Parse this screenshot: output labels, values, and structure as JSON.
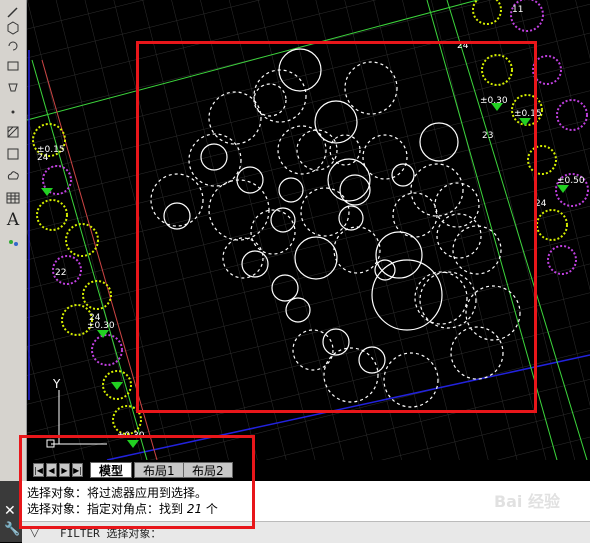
{
  "toolbar": {
    "tools": [
      "pencil-icon",
      "hexagon-icon",
      "rotate-icon",
      "stamp-icon",
      "bucket-icon",
      "point-icon",
      "hatch-icon",
      "region-icon",
      "cloud-icon",
      "table-icon",
      "text-icon",
      "attribute-icon"
    ],
    "text_tool_glyph": "A"
  },
  "canvas": {
    "plant_labels": [
      "11",
      "24",
      "±0.30",
      "23",
      "±0.15",
      "24",
      "±0.50",
      "22",
      "±0.15",
      "24",
      "±0.30",
      "24",
      "±0.30"
    ],
    "ucs_axis_label": "Y"
  },
  "layout_tabs": {
    "tabs": [
      {
        "label": "模型",
        "active": true
      },
      {
        "label": "布局1",
        "active": false
      },
      {
        "label": "布局2",
        "active": false
      }
    ],
    "separator": "/"
  },
  "command": {
    "history": [
      {
        "text": "选择对象：将过滤器应用到选择。"
      },
      {
        "prefix": "选择对象：指定对角点：找到 ",
        "count": "21",
        "suffix": " 个"
      }
    ],
    "input": "FILTER 选择对象："
  },
  "colors": {
    "highlight_box": "#e8161a",
    "grid": "#2d2d2d",
    "circle": "#ffffff",
    "green_line": "#3cd63c",
    "blue_line": "#2222dd",
    "yellow_plant": "#d7f000",
    "magenta_plant": "#c040e0"
  },
  "watermark": "Bai 经验"
}
